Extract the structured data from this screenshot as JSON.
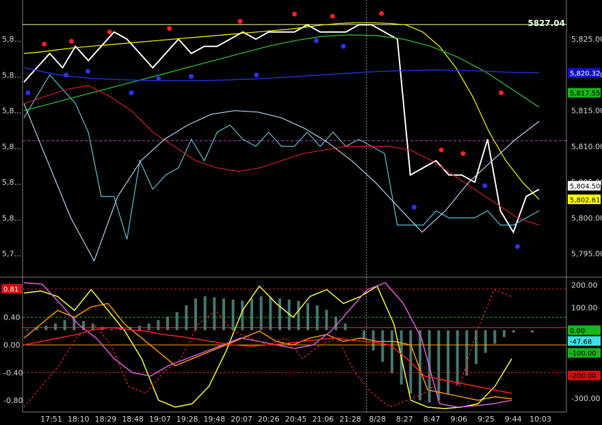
{
  "chart_data": [
    {
      "type": "line",
      "title": "",
      "last_price_label": "5827.04",
      "ylim": [
        5792,
        5830
      ],
      "x_labels": [
        "17:51",
        "18:10",
        "18:29",
        "18:48",
        "19:07",
        "19:28",
        "19:48",
        "20:07",
        "20:26",
        "20:45",
        "21:06",
        "21:28",
        "8/28",
        "8:27",
        "8:47",
        "9:06",
        "9:25",
        "9:44",
        "10:03"
      ],
      "left_y_labels": [
        "5,8...",
        "5,8...",
        "5,8...",
        "5,8...",
        "5,8...",
        "5,8...",
        "5,7..."
      ],
      "right_y_labels": [
        "5,825.00",
        "5,820.00",
        "5,815.00",
        "5,810.00",
        "5,805.00",
        "5,800.00",
        "5,795.00"
      ],
      "right_y_values": [
        5825,
        5820,
        5815,
        5810,
        5805,
        5800,
        5795
      ],
      "price_tags": [
        {
          "text": "5,820.32",
          "value": 5820.3,
          "bg": "#1010c8",
          "fg": "#ffffff"
        },
        {
          "text": "5,817.55",
          "value": 5817.5,
          "bg": "#16b716",
          "fg": "#000000"
        },
        {
          "text": "5,804.50",
          "value": 5804.5,
          "bg": "#ffffff",
          "fg": "#000000"
        },
        {
          "text": "5,802.61",
          "value": 5802.6,
          "bg": "#ffff00",
          "fg": "#000000"
        }
      ],
      "series": [
        {
          "color": "#ffffff",
          "values": [
            5819,
            5821,
            5823,
            5821,
            5824,
            5822,
            5824,
            5826,
            5825,
            5823,
            5821,
            5823,
            5825,
            5823,
            5824,
            5824,
            5825,
            5826,
            5825,
            5826,
            5826,
            5826,
            5827,
            5826,
            5826,
            5826,
            5827,
            5827,
            5826,
            5825,
            5806,
            5807,
            5808,
            5806,
            5806,
            5805,
            5811,
            5801,
            5798,
            5803,
            5804
          ]
        },
        {
          "color": "#5cc8d8",
          "values": [
            5814,
            5817,
            5820,
            5818,
            5816,
            5812,
            5803,
            5803,
            5797,
            5808,
            5804,
            5806,
            5807,
            5811,
            5808,
            5812,
            5813,
            5811,
            5810,
            5812,
            5810,
            5810,
            5812,
            5810,
            5812,
            5810,
            5811,
            5810,
            5809,
            5799,
            5799,
            5799,
            5801,
            5800,
            5800,
            5800,
            5801,
            5799,
            5799,
            5800,
            5801
          ]
        },
        {
          "color": "#ffff00",
          "values": [
            5823,
            5823.2,
            5823.5,
            5823.8,
            5824,
            5824.2,
            5824.4,
            5824.6,
            5824.8,
            5825,
            5825.2,
            5825.4,
            5825.6,
            5825.8,
            5826,
            5826.2,
            5826.4,
            5826.7,
            5827,
            5827.2,
            5827.3,
            5827.3,
            5827.2,
            5827,
            5826,
            5824,
            5821,
            5817,
            5812,
            5808,
            5805,
            5802.6
          ]
        },
        {
          "color": "#33cc33",
          "values": [
            5815,
            5816,
            5817,
            5818,
            5819,
            5820,
            5821,
            5822,
            5823,
            5824,
            5824.8,
            5825.4,
            5825.6,
            5825.5,
            5825,
            5824,
            5822.5,
            5820.5,
            5818,
            5815.5
          ]
        },
        {
          "color": "#2040ff",
          "values": [
            5821,
            5820,
            5819.5,
            5819.3,
            5819.2,
            5819.2,
            5819.3,
            5819.5,
            5819.8,
            5820.1,
            5820.4,
            5820.6,
            5820.7,
            5820.6,
            5820.4,
            5820.3
          ]
        },
        {
          "color": "#d02020",
          "values": [
            5816,
            5817,
            5818,
            5818.5,
            5817,
            5815,
            5812,
            5810,
            5808,
            5807,
            5806.5,
            5807,
            5808,
            5809,
            5809.5,
            5810,
            5810,
            5810,
            5809.5,
            5808,
            5806,
            5804,
            5802,
            5800,
            5799
          ]
        },
        {
          "color": "#b8d8f0",
          "values": [
            5816,
            5808,
            5800,
            5794,
            5803,
            5808,
            5811,
            5813,
            5814.5,
            5815,
            5814.8,
            5814,
            5812.5,
            5810.5,
            5808,
            5805,
            5801.5,
            5798,
            5801,
            5805,
            5808,
            5811,
            5813.5
          ]
        }
      ],
      "horizontal_lines": [
        {
          "value": 5827.04,
          "color": "#ffffa0",
          "style": "solid"
        },
        {
          "value": 5810.8,
          "color": "#c040c0",
          "style": "dashed"
        }
      ],
      "swing_points": [
        {
          "x": 0.04,
          "y": 5824.3,
          "color": "#ff2020"
        },
        {
          "x": 0.09,
          "y": 5824.7,
          "color": "#ff2020"
        },
        {
          "x": 0.16,
          "y": 5826,
          "color": "#ff2020"
        },
        {
          "x": 0.27,
          "y": 5826.5,
          "color": "#ff2020"
        },
        {
          "x": 0.4,
          "y": 5827.5,
          "color": "#ff2020"
        },
        {
          "x": 0.5,
          "y": 5828.5,
          "color": "#ff2020"
        },
        {
          "x": 0.57,
          "y": 5828.2,
          "color": "#ff2020"
        },
        {
          "x": 0.66,
          "y": 5828.6,
          "color": "#ff2020"
        },
        {
          "x": 0.77,
          "y": 5809.5,
          "color": "#ff2020"
        },
        {
          "x": 0.81,
          "y": 5809,
          "color": "#ff2020"
        },
        {
          "x": 0.88,
          "y": 5817.5,
          "color": "#ff2020"
        },
        {
          "x": 0.01,
          "y": 5817.5,
          "color": "#3030ff"
        },
        {
          "x": 0.08,
          "y": 5820,
          "color": "#3030ff"
        },
        {
          "x": 0.12,
          "y": 5820.5,
          "color": "#3030ff"
        },
        {
          "x": 0.2,
          "y": 5817.5,
          "color": "#3030ff"
        },
        {
          "x": 0.25,
          "y": 5819.5,
          "color": "#3030ff"
        },
        {
          "x": 0.31,
          "y": 5819.8,
          "color": "#3030ff"
        },
        {
          "x": 0.43,
          "y": 5820,
          "color": "#3030ff"
        },
        {
          "x": 0.54,
          "y": 5824.8,
          "color": "#3030ff"
        },
        {
          "x": 0.59,
          "y": 5824,
          "color": "#3030ff"
        },
        {
          "x": 0.72,
          "y": 5801.5,
          "color": "#3030ff"
        },
        {
          "x": 0.85,
          "y": 5804.5,
          "color": "#3030ff"
        },
        {
          "x": 0.91,
          "y": 5796,
          "color": "#3030ff"
        }
      ]
    },
    {
      "type": "line",
      "title": "",
      "ylim": [
        -0.95,
        0.95
      ],
      "left_y_labels": [
        "0.81",
        "0.40",
        "0.00",
        "-0.40",
        "-0.80"
      ],
      "left_y_values": [
        0.81,
        0.4,
        0.0,
        -0.4,
        -0.8
      ],
      "right_y_labels": [
        "200.00",
        "100.00",
        "0.00",
        "-47.68",
        "-100.00",
        "-200.00",
        "-300.00"
      ],
      "right_y_values": [
        200,
        100,
        0,
        -47.68,
        -100,
        -200,
        -300
      ],
      "right_ylim": [
        -355,
        225
      ],
      "tags": [
        {
          "text": "0.81",
          "side": "left",
          "value": 0.81,
          "bg": "#d01010",
          "fg": "#ffffff"
        },
        {
          "text": "0.00",
          "side": "right",
          "value": 0,
          "bg": "#16b716",
          "fg": "#000000"
        },
        {
          "text": "-47.68",
          "side": "right",
          "value": -47.68,
          "bg": "#40e0e0",
          "fg": "#000000"
        },
        {
          "text": "-100.00",
          "side": "right",
          "value": -100,
          "bg": "#16b716",
          "fg": "#000000"
        },
        {
          "text": "-200.00",
          "side": "right",
          "value": -200,
          "bg": "#d01010",
          "fg": "#000000"
        }
      ],
      "histogram": [
        5,
        10,
        20,
        30,
        45,
        55,
        40,
        30,
        15,
        5,
        10,
        15,
        20,
        30,
        45,
        60,
        80,
        110,
        140,
        150,
        145,
        140,
        135,
        130,
        140,
        150,
        145,
        140,
        135,
        130,
        120,
        110,
        90,
        60,
        30,
        0,
        -40,
        -90,
        -140,
        -190,
        -240,
        -280,
        -310,
        -320,
        -310,
        -280,
        -240,
        -200,
        -150,
        -100,
        -60,
        -30,
        -10,
        0,
        -10
      ],
      "series": [
        {
          "name": "",
          "color": "#ff9900",
          "values": [
            0.1,
            0.3,
            0.5,
            0.4,
            0.55,
            0.6,
            0.3,
            0.1,
            -0.1,
            -0.3,
            -0.2,
            -0.1,
            0,
            0.1,
            0.2,
            0.05,
            0,
            0.1,
            0.15,
            0.05,
            0.1,
            0.05,
            0.05,
            0.0,
            -0.65,
            -0.7,
            -0.75,
            -0.8,
            -0.75,
            -0.78
          ]
        },
        {
          "name": "",
          "color": "#ffff40",
          "values": [
            0.75,
            0.78,
            0.7,
            0.5,
            0.8,
            0.5,
            0.2,
            -0.2,
            -0.8,
            -0.9,
            -0.85,
            -0.6,
            -0.1,
            0.5,
            0.85,
            0.6,
            0.4,
            0.7,
            0.8,
            0.6,
            0.7,
            0.85,
            0.3,
            -0.8,
            -0.9,
            -0.92,
            -0.9,
            -0.85,
            -0.6,
            -0.2
          ]
        },
        {
          "name": "",
          "color": "#e060e0",
          "values": [
            0.9,
            0.88,
            0.6,
            0.3,
            0.1,
            -0.2,
            -0.4,
            -0.45,
            -0.3,
            -0.2,
            -0.1,
            0,
            0.1,
            0.05,
            0,
            -0.05,
            0,
            0.2,
            0.5,
            0.8,
            0.9,
            0.6,
            0.1,
            -0.85,
            -0.9,
            -0.88,
            -0.85,
            -0.8
          ]
        },
        {
          "name": "",
          "color": "#ff2020",
          "values": [
            0.0,
            0.05,
            0.1,
            0.15,
            0.22,
            0.25,
            0.22,
            0.2,
            0.15,
            0.12,
            0.08,
            0.04,
            0.0,
            -0.02,
            0.0,
            0.02,
            0.05,
            0.08,
            0.1,
            0.06,
            0.04,
            0.0,
            -0.2,
            -0.45,
            -0.5,
            -0.55,
            -0.6,
            -0.65,
            -0.7
          ]
        },
        {
          "name": "",
          "color": "#d02020",
          "dash": true,
          "values": [
            -0.9,
            -0.6,
            -0.3,
            0.1,
            0.3,
            0.0,
            -0.6,
            -0.7,
            -0.4,
            -0.2,
            0.3,
            0.5,
            0.2,
            0.1,
            0.0,
            0.1,
            -0.2,
            0.0,
            0.1,
            -0.4,
            -0.7,
            -0.9,
            -0.8,
            -0.7,
            -0.5,
            -0.6,
            0.2,
            0.8,
            0.7
          ]
        }
      ],
      "horizontal_lines": [
        {
          "value": 0.81,
          "color": "#d02020",
          "style": "dashed"
        },
        {
          "value": 0.4,
          "color": "#20c020",
          "style": "dashed"
        },
        {
          "value": 0.0,
          "color": "#ffa500",
          "style": "solid"
        },
        {
          "value": 0.25,
          "color": "#ff3030",
          "style": "solid"
        },
        {
          "value": -0.4,
          "color": "#d02020",
          "style": "dashed"
        }
      ]
    }
  ]
}
